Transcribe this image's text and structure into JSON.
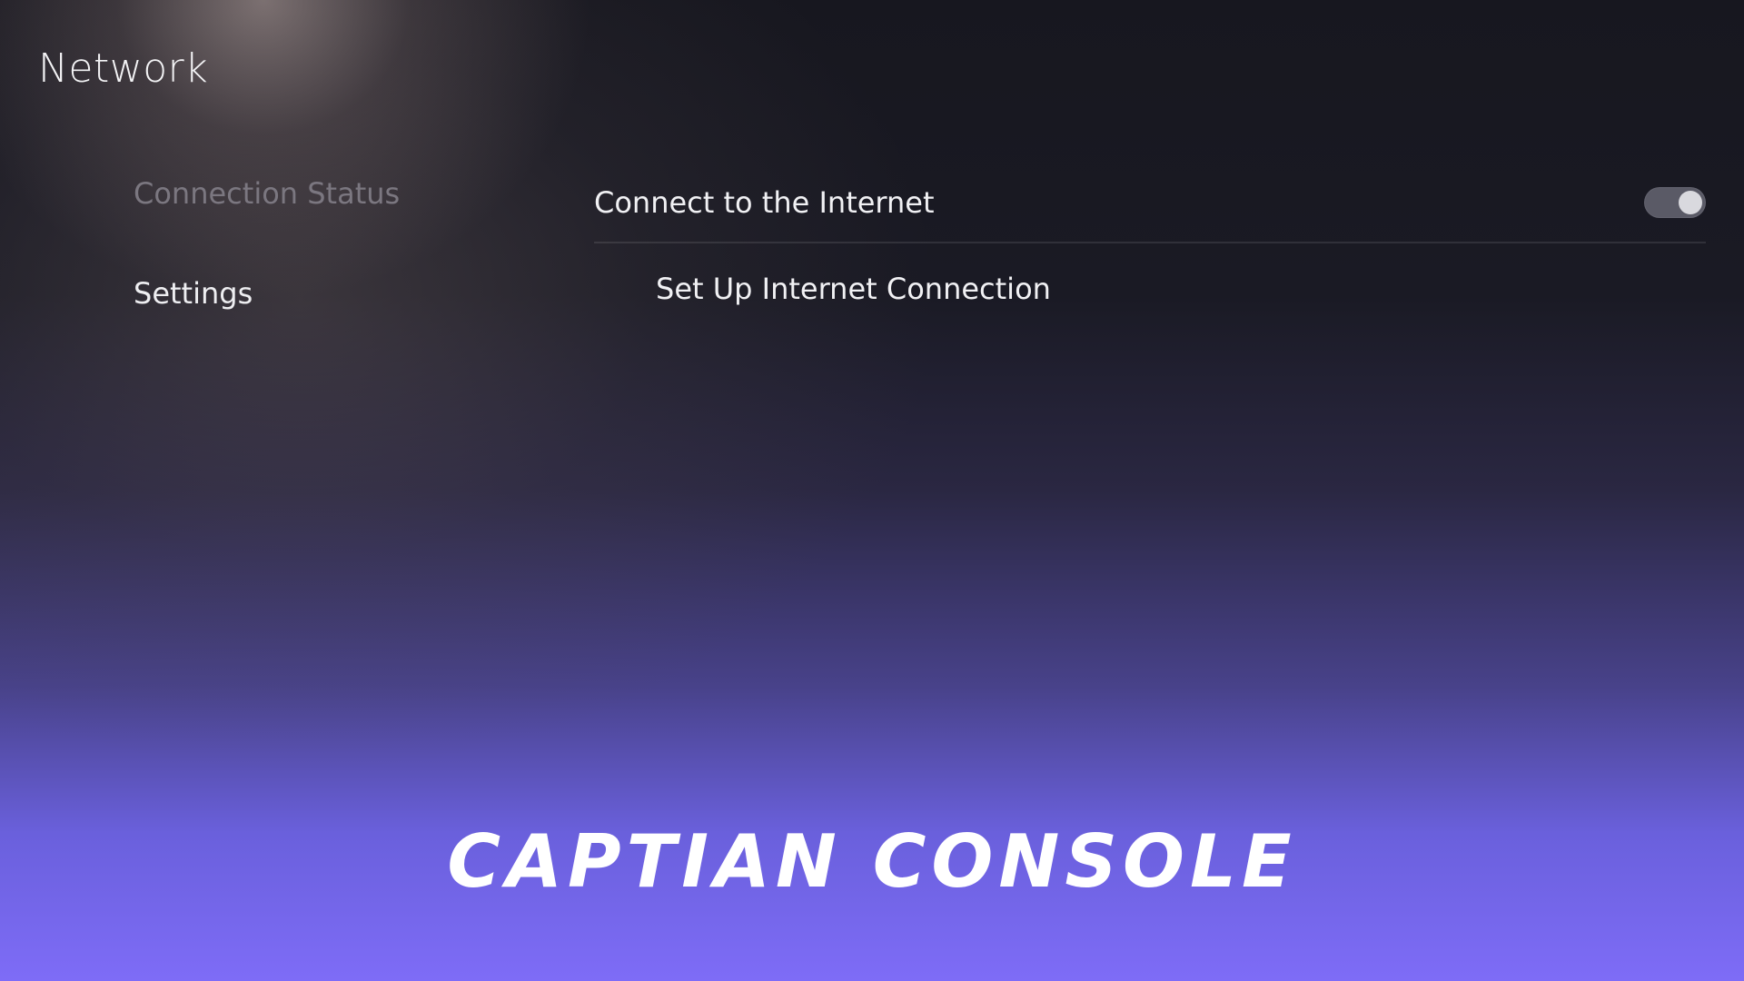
{
  "header": {
    "title": "Network"
  },
  "sidebar": {
    "items": [
      {
        "label": "Connection Status"
      },
      {
        "label": "Settings"
      }
    ]
  },
  "main": {
    "rows": [
      {
        "label": "Connect to the Internet",
        "toggle_state": "on"
      },
      {
        "label": "Set Up Internet Connection"
      }
    ]
  },
  "branding": {
    "text": "CAPTIAN CONSOLE"
  },
  "colors": {
    "accent_bottom": "#7e6cf7",
    "background_top": "#17171f",
    "toggle_track": "#5a5a66",
    "toggle_knob": "#d9d9de"
  }
}
